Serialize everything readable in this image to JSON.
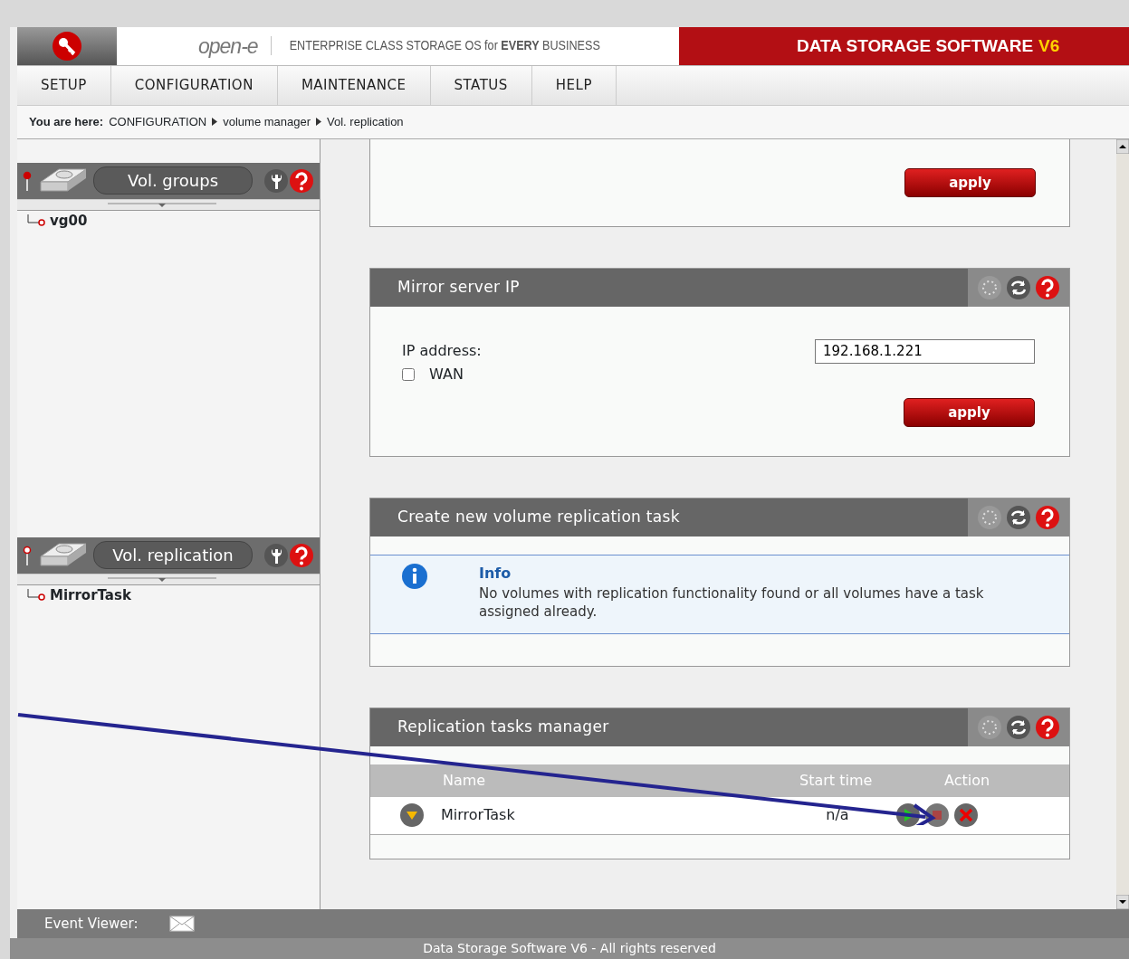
{
  "header": {
    "logo_text": "open-e",
    "tagline": "ENTERPRISE CLASS STORAGE OS for **EVERY** BUSINESS",
    "product_name": "DATA STORAGE SOFTWARE",
    "product_version": "V6"
  },
  "nav": [
    "SETUP",
    "CONFIGURATION",
    "MAINTENANCE",
    "STATUS",
    "HELP"
  ],
  "breadcrumb": {
    "label": "You are here:",
    "items": [
      "CONFIGURATION",
      "volume manager",
      "Vol. replication"
    ]
  },
  "sidebar": [
    {
      "title": "Vol. groups",
      "selected": true,
      "items": [
        "vg00"
      ]
    },
    {
      "title": "Vol. replication",
      "selected": false,
      "items": [
        "MirrorTask"
      ]
    }
  ],
  "panels": [
    {
      "kind": "partial",
      "button": "apply"
    },
    {
      "kind": "ip",
      "title": "Mirror server IP",
      "ip_label": "IP address:",
      "ip_value": "192.168.1.221",
      "wan": {
        "label": "WAN",
        "checked": false
      },
      "button": "apply"
    },
    {
      "kind": "info",
      "title": "Create new volume replication task",
      "info_title": "Info",
      "info_text": "No volumes with replication functionality found or all volumes have a task assigned already."
    },
    {
      "kind": "table",
      "title": "Replication tasks manager",
      "columns": [
        "Name",
        "Start time",
        "Action"
      ],
      "rows": [
        {
          "name": "MirrorTask",
          "start_time": "n/a"
        }
      ]
    }
  ],
  "event_viewer": "Event Viewer:",
  "footer": "Data Storage Software V6 - All rights reserved"
}
